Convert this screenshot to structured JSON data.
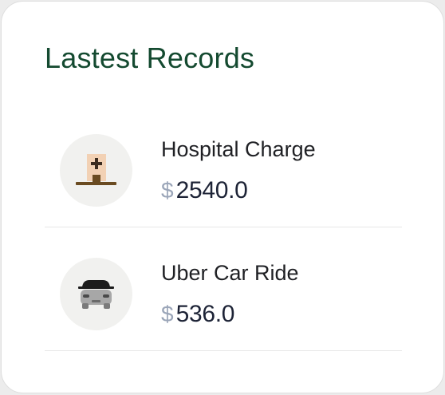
{
  "card": {
    "title": "Lastest Records",
    "records": [
      {
        "name": "Hospital Charge",
        "currency": "$",
        "amount": "2540.0",
        "icon": "hospital-icon"
      },
      {
        "name": "Uber Car Ride",
        "currency": "$",
        "amount": "536.0",
        "icon": "car-icon"
      }
    ]
  },
  "colors": {
    "title": "#144a30",
    "amount": "#1d2336",
    "currency": "#9aa5b8",
    "icon_bg": "#f1f1ef"
  }
}
